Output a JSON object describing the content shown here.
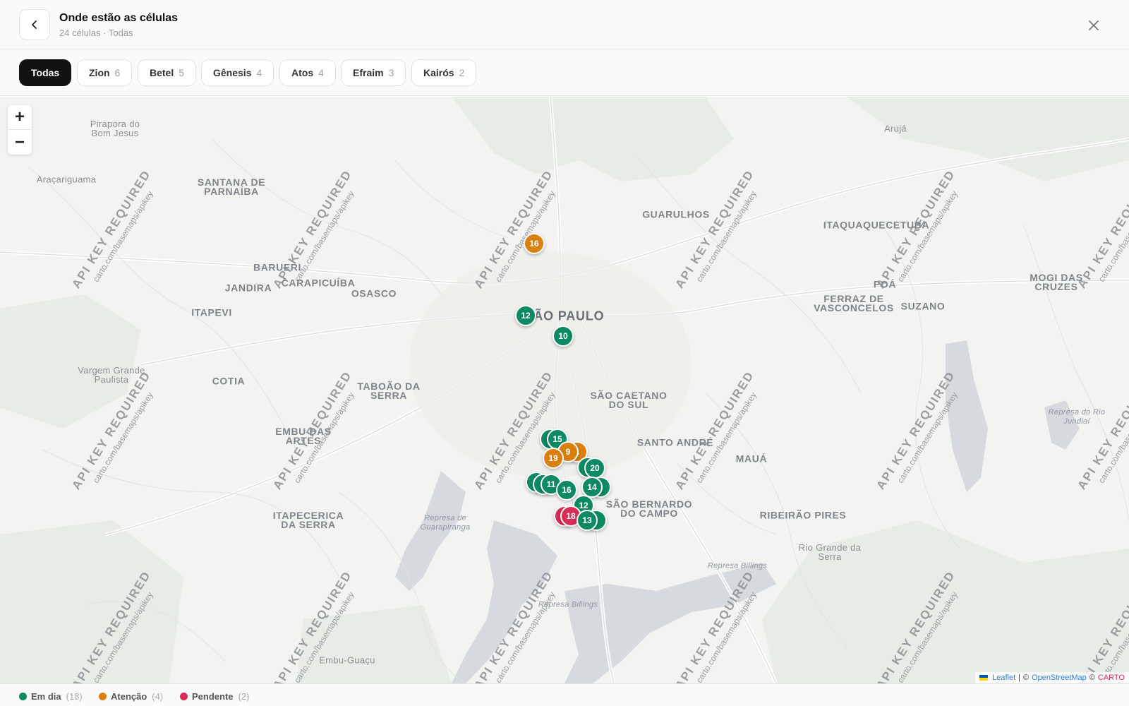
{
  "header": {
    "title": "Onde estão as células",
    "subtitle": "24 células · Todas"
  },
  "filters": [
    {
      "label": "Todas",
      "count": ""
    },
    {
      "label": "Zion",
      "count": "6"
    },
    {
      "label": "Betel",
      "count": "5"
    },
    {
      "label": "Gênesis",
      "count": "4"
    },
    {
      "label": "Atos",
      "count": "4"
    },
    {
      "label": "Efraim",
      "count": "3"
    },
    {
      "label": "Kairós",
      "count": "2"
    }
  ],
  "map": {
    "zoom_in": "+",
    "zoom_out": "−",
    "watermark_title": "API KEY REQUIRED",
    "watermark_url": "carto.com/basemaps/apikey",
    "labels": {
      "pirapora": "Pirapora do\nBom Jesus",
      "aruja": "Arujá",
      "aracariguama": "Araçariguama",
      "santana": "SANTANA DE\nPARNAÍBA",
      "guarulhos": "GUARULHOS",
      "itaquaquecetuba": "ITAQUAQUECETUBA",
      "barueri": "BARUERI",
      "jandira": "JANDIRA",
      "carapicuiba": "CARAPICUÍBA",
      "osasco": "OSASCO",
      "poa": "POÁ",
      "mogi": "MOGI DAS\nCRUZES",
      "ferraz": "FERRAZ DE\nVASCONCELOS",
      "suzano": "SUZANO",
      "itapevi": "ITAPEVI",
      "sao_paulo": "SÃO PAULO",
      "vargem": "Vargem Grande\nPaulista",
      "cotia": "COTIA",
      "taboao": "TABOÃO DA\nSERRA",
      "sao_caetano": "SÃO CAETANO\nDO SUL",
      "embu": "EMBU DAS\nARTES",
      "santo_andre": "SANTO ANDRÉ",
      "maua": "MAUÁ",
      "sao_bernardo": "SÃO BERNARDO\nDO CAMPO",
      "itapecerica": "ITAPECERICA\nDA SERRA",
      "guarapiranga": "Represa de\nGuarapiranga",
      "ribeirao": "RIBEIRÃO PIRES",
      "rio_grande": "Rio Grande da\nSerra",
      "billings1": "Represa Billings",
      "billings2": "Represa Billings",
      "embu_guacu": "Embu-Guaçu",
      "rio_jundiai": "Represa do Rio\nJundiaí"
    },
    "pins": [
      {
        "label": "16",
        "status": "atencao"
      },
      {
        "label": "12",
        "status": "em_dia"
      },
      {
        "label": "10",
        "status": "em_dia"
      },
      {
        "label": "",
        "status": "em_dia"
      },
      {
        "label": "15",
        "status": "em_dia"
      },
      {
        "label": "1",
        "status": "atencao"
      },
      {
        "label": "9",
        "status": "atencao"
      },
      {
        "label": "19",
        "status": "atencao"
      },
      {
        "label": "",
        "status": "em_dia"
      },
      {
        "label": "20",
        "status": "em_dia"
      },
      {
        "label": "",
        "status": "em_dia"
      },
      {
        "label": "",
        "status": "em_dia"
      },
      {
        "label": "11",
        "status": "em_dia"
      },
      {
        "label": "16",
        "status": "em_dia"
      },
      {
        "label": "5",
        "status": "em_dia"
      },
      {
        "label": "14",
        "status": "em_dia"
      },
      {
        "label": "12",
        "status": "em_dia"
      },
      {
        "label": "",
        "status": "pendente"
      },
      {
        "label": "18",
        "status": "pendente"
      },
      {
        "label": "",
        "status": "em_dia"
      },
      {
        "label": "13",
        "status": "em_dia"
      }
    ],
    "attribution": {
      "leaflet": "Leaflet",
      "sep1": "|",
      "osm_prefix": "©",
      "osm": "OpenStreetMap",
      "carto_prefix": "©",
      "carto": "CARTO"
    }
  },
  "legend": [
    {
      "label": "Em dia",
      "count": "(18)",
      "color": "#0d8a64"
    },
    {
      "label": "Atenção",
      "count": "(4)",
      "color": "#d9800f"
    },
    {
      "label": "Pendente",
      "count": "(2)",
      "color": "#d72d56"
    }
  ],
  "colors": {
    "em_dia": "#0d8a64",
    "atencao": "#d9800f",
    "pendente": "#d72d56"
  }
}
